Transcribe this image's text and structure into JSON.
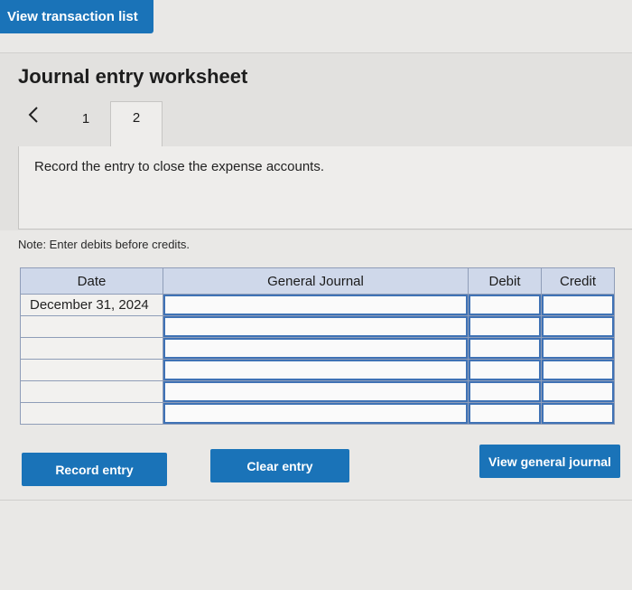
{
  "top": {
    "view_transaction_list": "View transaction list"
  },
  "worksheet": {
    "title": "Journal entry worksheet",
    "tabs": [
      {
        "label": "1"
      },
      {
        "label": "2"
      }
    ],
    "active_tab": "2",
    "instruction": "Record the entry to close the expense accounts.",
    "note": "Note: Enter debits before credits."
  },
  "table": {
    "headers": {
      "date": "Date",
      "journal": "General Journal",
      "debit": "Debit",
      "credit": "Credit"
    },
    "rows": [
      {
        "date": "December 31, 2024"
      },
      {
        "date": ""
      },
      {
        "date": ""
      },
      {
        "date": ""
      },
      {
        "date": ""
      },
      {
        "date": ""
      }
    ]
  },
  "buttons": {
    "record": "Record entry",
    "clear": "Clear entry",
    "view_general_journal": "View general journal"
  },
  "colors": {
    "accent": "#1a73b8",
    "header_bg": "#cfd8ea",
    "input_border": "#3f72b5"
  }
}
